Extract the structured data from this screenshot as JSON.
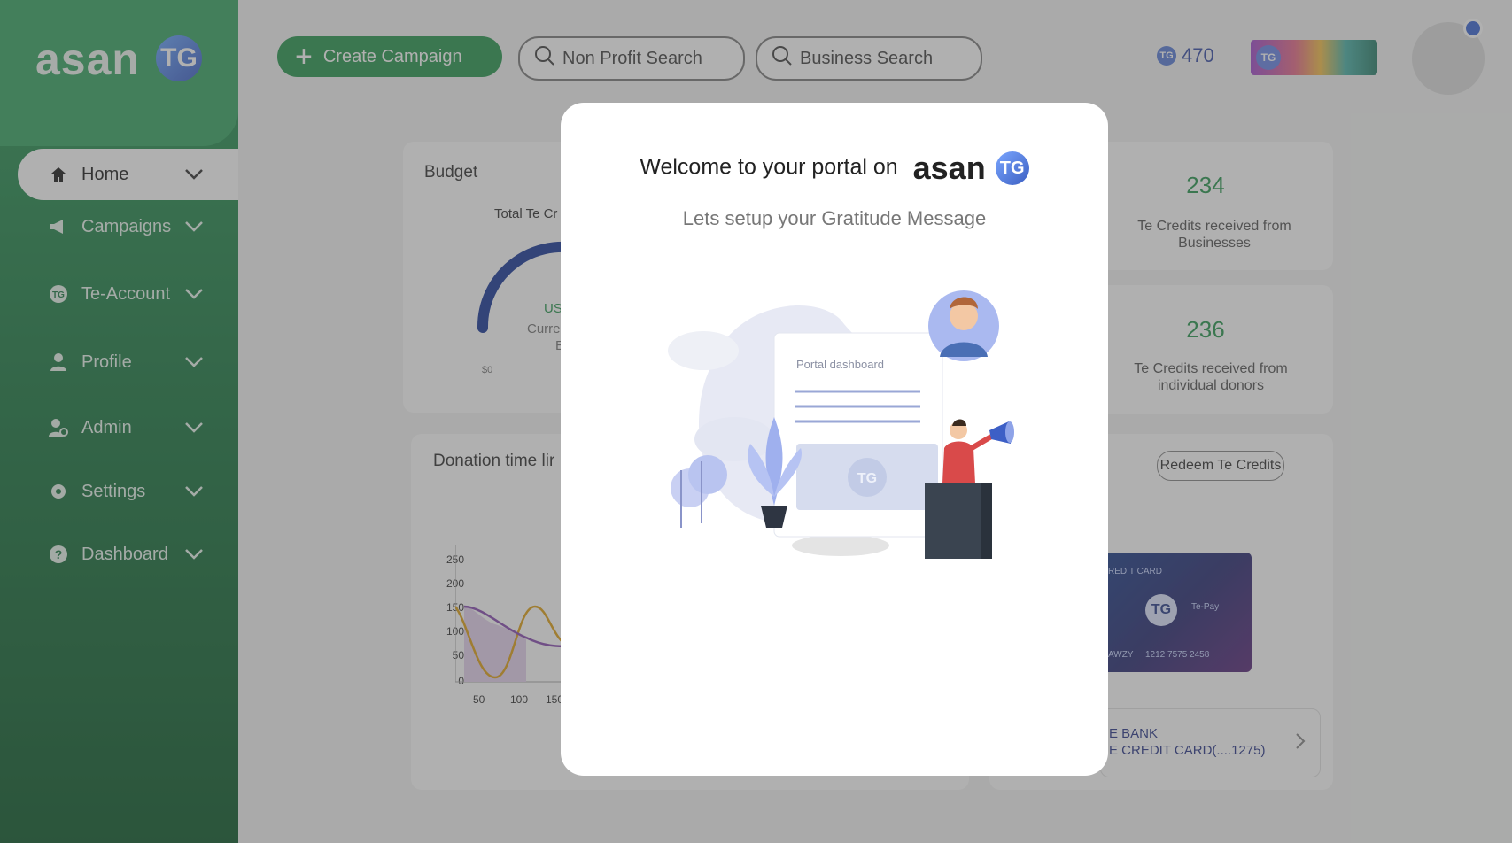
{
  "brand": {
    "name": "asan",
    "mark": "TG"
  },
  "sidebar": {
    "items": [
      {
        "label": "Home",
        "icon": "home-icon"
      },
      {
        "label": "Campaigns",
        "icon": "megaphone-icon"
      },
      {
        "label": "Te-Account",
        "icon": "te-account-icon"
      },
      {
        "label": "Profile",
        "icon": "person-icon"
      },
      {
        "label": "Admin",
        "icon": "admin-icon"
      },
      {
        "label": "Settings",
        "icon": "gear-icon"
      },
      {
        "label": "Dashboard",
        "icon": "help-icon"
      }
    ]
  },
  "topbar": {
    "create_label": "Create Campaign",
    "nonprofit_search": "Non Profit Search",
    "business_search": "Business Search",
    "credits": "470"
  },
  "budget": {
    "title": "Budget",
    "total_label": "Total Te Cr",
    "gauge_min": "$0",
    "gauge_value_prefix": "US",
    "gauge_caption1": "Curre",
    "gauge_caption2": "E"
  },
  "stats": [
    {
      "value": "234",
      "label": "Te Credits received from Businesses"
    },
    {
      "value": "236",
      "label": "Te Credits received from individual donors"
    }
  ],
  "timeline": {
    "title": "Donation time lir",
    "y_ticks": [
      "250",
      "200",
      "150",
      "100",
      "50",
      "0"
    ],
    "x_ticks": [
      "50",
      "100",
      "150"
    ]
  },
  "wallet": {
    "redeem_label": "Redeem Te Credits",
    "card_top": "REDIT CARD",
    "card_pay": "Te-Pay",
    "card_name": "AWZY",
    "card_number": "1212 7575 2458",
    "bank_line1": "E BANK",
    "bank_line2": "E CREDIT CARD(....1275)"
  },
  "modal": {
    "title": "Welcome to your portal on",
    "brand": "asan",
    "brand_mark": "TG",
    "subtitle": "Lets setup your Gratitude Message",
    "illustration_label": "Portal dashboard",
    "illustration_mark": "TG"
  }
}
